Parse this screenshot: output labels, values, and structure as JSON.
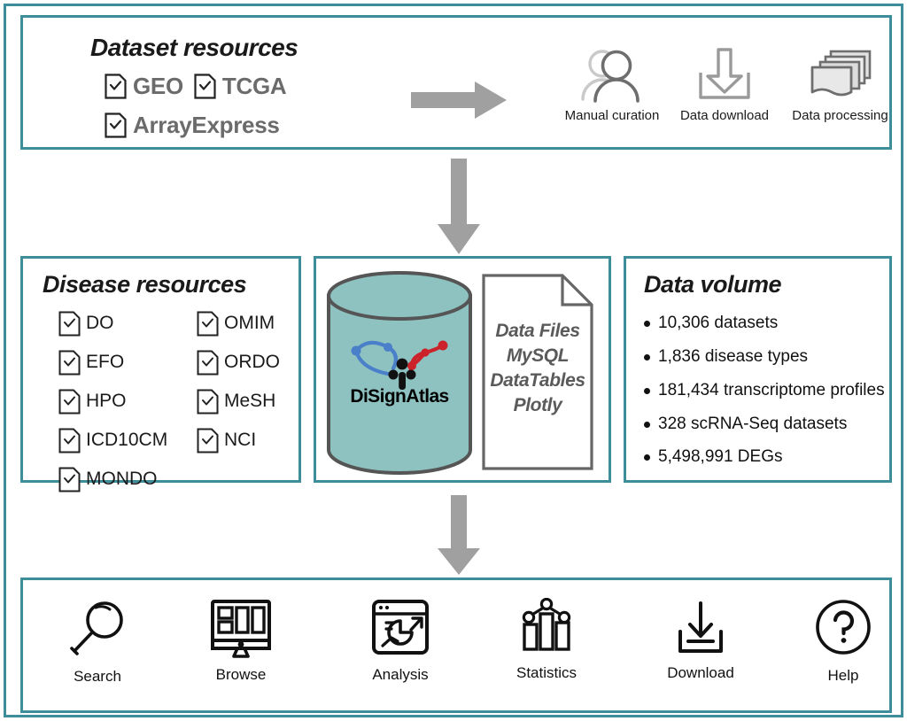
{
  "colors": {
    "panel_border": "#3d8d9b",
    "arrow_gray": "#a0a0a0",
    "cylinder_fill": "#8ec2c0",
    "cylinder_stroke": "#555555",
    "logo_blue": "#4a7fc9",
    "logo_red": "#cc2229",
    "label_gray": "#6b6b6b",
    "doc_text_gray": "#5a5a5a",
    "icon_dark": "#111111"
  },
  "dataset_panel": {
    "title": "Dataset resources",
    "items_row1": [
      {
        "label": "GEO",
        "icon": "document-check-icon"
      },
      {
        "label": "TCGA",
        "icon": "document-check-icon"
      }
    ],
    "items_row2": [
      {
        "label": "ArrayExpress",
        "icon": "document-check-icon"
      }
    ],
    "flow_arrow": "arrow-right-icon",
    "process_icons": [
      {
        "label": "Manual curation",
        "icon": "users-icon"
      },
      {
        "label": "Data download",
        "icon": "download-tray-icon"
      },
      {
        "label": "Data processing",
        "icon": "stacked-documents-icon"
      }
    ]
  },
  "arrows": {
    "vertical_top": "arrow-down-icon",
    "vertical_bottom": "arrow-down-icon"
  },
  "disease_panel": {
    "title": "Disease resources",
    "column_left": [
      {
        "label": "DO",
        "icon": "document-check-icon"
      },
      {
        "label": "EFO",
        "icon": "document-check-icon"
      },
      {
        "label": "HPO",
        "icon": "document-check-icon"
      },
      {
        "label": "ICD10CM",
        "icon": "document-check-icon"
      },
      {
        "label": "MONDO",
        "icon": "document-check-icon"
      }
    ],
    "column_right": [
      {
        "label": "OMIM",
        "icon": "document-check-icon"
      },
      {
        "label": "ORDO",
        "icon": "document-check-icon"
      },
      {
        "label": "MeSH",
        "icon": "document-check-icon"
      },
      {
        "label": "NCI",
        "icon": "document-check-icon"
      }
    ]
  },
  "center_panel": {
    "database_icon": "database-cylinder-icon",
    "logo_name": "DiSignAtlas",
    "logo_icon": "disignatlas-network-logo",
    "document_icon": "document-page-icon",
    "tech_stack": [
      "Data Files",
      "MySQL",
      "DataTables",
      "Plotly"
    ]
  },
  "volume_panel": {
    "title": "Data volume",
    "stats": [
      "10,306 datasets",
      "1,836 disease types",
      "181,434 transcriptome profiles",
      "328 scRNA-Seq datasets",
      "5,498,991 DEGs"
    ]
  },
  "tools_panel": {
    "tools": [
      {
        "label": "Search",
        "icon": "magnifier-icon"
      },
      {
        "label": "Browse",
        "icon": "monitor-icon"
      },
      {
        "label": "Analysis",
        "icon": "analytics-window-icon"
      },
      {
        "label": "Statistics",
        "icon": "bar-chart-icon"
      },
      {
        "label": "Download",
        "icon": "download-tray-icon"
      },
      {
        "label": "Help",
        "icon": "question-circle-icon"
      }
    ]
  }
}
